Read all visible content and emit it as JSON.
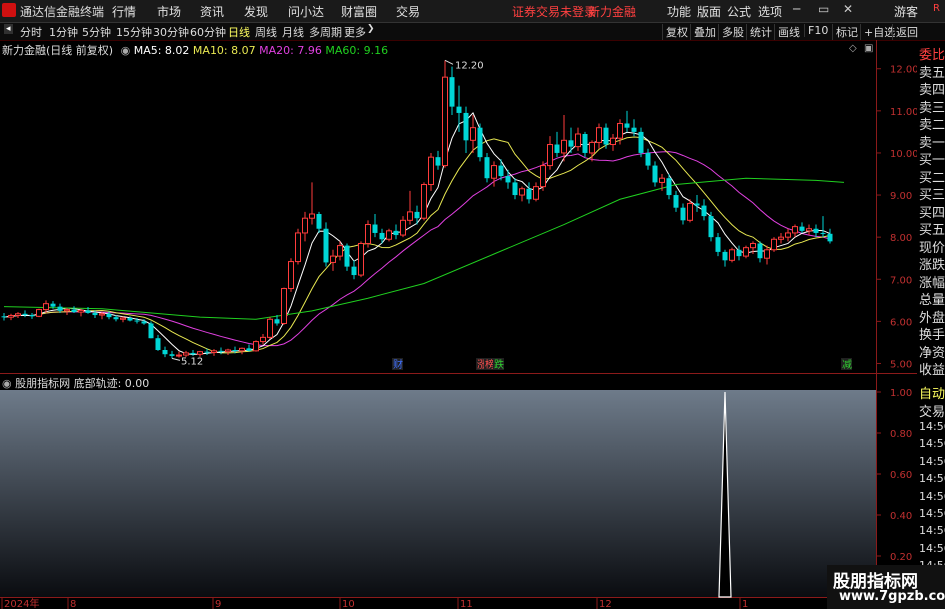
{
  "menu": {
    "app_title": "通达信金融终端",
    "items": [
      "行情",
      "市场",
      "资讯",
      "发现",
      "问小达",
      "财富圈",
      "交易"
    ],
    "status_red": "证券交易未登录",
    "brand_red": "新力金融",
    "right_items": [
      "功能",
      "版面",
      "公式",
      "选项"
    ],
    "guest": "游客",
    "r_badge": "R"
  },
  "toolbar": {
    "periods": [
      "分时",
      "1分钟",
      "5分钟",
      "15分钟",
      "30分钟",
      "60分钟",
      "日线",
      "周线",
      "月线",
      "多周期",
      "更多"
    ],
    "active_period": "日线",
    "right_buttons": [
      "复权",
      "叠加",
      "多股",
      "统计",
      "画线",
      "F10",
      "标记",
      "+自选",
      "返回"
    ]
  },
  "info": {
    "stock": "新力金融(日线 前复权)",
    "ma5": "MA5: 8.02",
    "ma10": "MA10: 8.07",
    "ma20": "MA20: 7.96",
    "ma60": "MA60: 9.16"
  },
  "chart_data": {
    "type": "candlestick",
    "y_ticks": [
      "12.00",
      "11.00",
      "10.00",
      "9.00",
      "8.00",
      "7.00",
      "6.00",
      "5.00"
    ],
    "ylim": [
      4.75,
      12.35
    ],
    "x_ticks": [
      "2024年",
      "8",
      "9",
      "10",
      "11",
      "12",
      "1"
    ],
    "high_label": "12.20",
    "low_label": "5.12",
    "event_markers": [
      "财",
      "涨",
      "榜",
      "跌",
      "减"
    ],
    "colors": {
      "up": "#ff3c3c",
      "down": "#00d6d6",
      "ma5": "#ffffff",
      "ma10": "#e8e852",
      "ma20": "#e040e0",
      "ma60": "#20d020"
    },
    "candles": [
      [
        6.12,
        6.2,
        6.02,
        6.1
      ],
      [
        6.1,
        6.18,
        6.03,
        6.14
      ],
      [
        6.14,
        6.22,
        6.08,
        6.18
      ],
      [
        6.18,
        6.26,
        6.1,
        6.15
      ],
      [
        6.15,
        6.2,
        6.06,
        6.12
      ],
      [
        6.12,
        6.3,
        6.1,
        6.28
      ],
      [
        6.28,
        6.5,
        6.2,
        6.42
      ],
      [
        6.42,
        6.48,
        6.3,
        6.35
      ],
      [
        6.35,
        6.42,
        6.2,
        6.25
      ],
      [
        6.25,
        6.32,
        6.15,
        6.28
      ],
      [
        6.28,
        6.36,
        6.2,
        6.22
      ],
      [
        6.22,
        6.3,
        6.12,
        6.26
      ],
      [
        6.26,
        6.34,
        6.18,
        6.2
      ],
      [
        6.2,
        6.26,
        6.08,
        6.15
      ],
      [
        6.15,
        6.22,
        6.05,
        6.18
      ],
      [
        6.18,
        6.24,
        6.05,
        6.1
      ],
      [
        6.1,
        6.15,
        6.0,
        6.05
      ],
      [
        6.05,
        6.12,
        5.98,
        6.08
      ],
      [
        6.08,
        6.12,
        6.0,
        6.02
      ],
      [
        6.02,
        6.08,
        5.95,
        6.0
      ],
      [
        6.0,
        6.05,
        5.92,
        5.95
      ],
      [
        5.95,
        6.0,
        5.6,
        5.6
      ],
      [
        5.6,
        5.68,
        5.3,
        5.32
      ],
      [
        5.32,
        5.4,
        5.15,
        5.22
      ],
      [
        5.22,
        5.3,
        5.12,
        5.18
      ],
      [
        5.18,
        5.28,
        5.14,
        5.2
      ],
      [
        5.2,
        5.3,
        5.15,
        5.25
      ],
      [
        5.25,
        5.32,
        5.18,
        5.22
      ],
      [
        5.22,
        5.3,
        5.16,
        5.28
      ],
      [
        5.28,
        5.35,
        5.2,
        5.26
      ],
      [
        5.26,
        5.34,
        5.18,
        5.3
      ],
      [
        5.3,
        5.38,
        5.22,
        5.28
      ],
      [
        5.28,
        5.35,
        5.2,
        5.32
      ],
      [
        5.32,
        5.4,
        5.24,
        5.3
      ],
      [
        5.3,
        5.38,
        5.22,
        5.36
      ],
      [
        5.36,
        5.45,
        5.28,
        5.3
      ],
      [
        5.3,
        5.55,
        5.28,
        5.52
      ],
      [
        5.52,
        5.7,
        5.45,
        5.62
      ],
      [
        5.62,
        6.1,
        5.58,
        6.05
      ],
      [
        6.05,
        6.15,
        5.9,
        5.95
      ],
      [
        5.95,
        6.8,
        5.92,
        6.78
      ],
      [
        6.78,
        7.5,
        6.7,
        7.42
      ],
      [
        7.42,
        8.2,
        7.35,
        8.1
      ],
      [
        8.1,
        8.6,
        7.9,
        8.45
      ],
      [
        8.45,
        9.3,
        8.3,
        8.55
      ],
      [
        8.55,
        8.6,
        8.1,
        8.2
      ],
      [
        8.2,
        8.35,
        7.3,
        7.4
      ],
      [
        7.4,
        7.7,
        7.2,
        7.55
      ],
      [
        7.55,
        7.9,
        7.45,
        7.8
      ],
      [
        7.8,
        7.85,
        7.2,
        7.3
      ],
      [
        7.3,
        7.45,
        7.0,
        7.1
      ],
      [
        7.1,
        7.9,
        7.05,
        7.85
      ],
      [
        7.85,
        8.4,
        7.75,
        8.3
      ],
      [
        8.3,
        8.55,
        8.0,
        8.1
      ],
      [
        8.1,
        8.2,
        7.85,
        7.95
      ],
      [
        7.95,
        8.2,
        7.9,
        8.15
      ],
      [
        8.15,
        8.3,
        7.95,
        8.05
      ],
      [
        8.05,
        8.5,
        8.0,
        8.4
      ],
      [
        8.4,
        9.1,
        8.3,
        8.6
      ],
      [
        8.6,
        8.75,
        8.3,
        8.45
      ],
      [
        8.45,
        9.3,
        8.4,
        9.25
      ],
      [
        9.25,
        10.0,
        9.1,
        9.9
      ],
      [
        9.9,
        10.05,
        9.6,
        9.7
      ],
      [
        9.7,
        12.2,
        9.65,
        11.8
      ],
      [
        11.8,
        12.05,
        10.9,
        11.1
      ],
      [
        11.1,
        11.6,
        10.5,
        10.95
      ],
      [
        10.95,
        11.1,
        10.0,
        10.3
      ],
      [
        10.3,
        10.9,
        10.0,
        10.6
      ],
      [
        10.6,
        10.7,
        9.8,
        9.9
      ],
      [
        9.9,
        10.0,
        9.3,
        9.4
      ],
      [
        9.4,
        9.8,
        9.2,
        9.7
      ],
      [
        9.7,
        9.85,
        9.35,
        9.45
      ],
      [
        9.45,
        9.6,
        9.15,
        9.3
      ],
      [
        9.3,
        9.4,
        8.9,
        9.0
      ],
      [
        9.0,
        9.2,
        8.85,
        9.15
      ],
      [
        9.15,
        9.3,
        8.8,
        8.9
      ],
      [
        8.9,
        9.3,
        8.85,
        9.2
      ],
      [
        9.2,
        9.8,
        9.1,
        9.7
      ],
      [
        9.7,
        10.4,
        9.6,
        10.2
      ],
      [
        10.2,
        10.5,
        9.9,
        10.0
      ],
      [
        10.0,
        10.9,
        9.8,
        10.3
      ],
      [
        10.3,
        10.6,
        10.0,
        10.15
      ],
      [
        10.15,
        10.6,
        10.05,
        10.45
      ],
      [
        10.45,
        10.5,
        9.9,
        10.0
      ],
      [
        10.0,
        10.3,
        9.8,
        10.25
      ],
      [
        10.25,
        10.7,
        10.1,
        10.6
      ],
      [
        10.6,
        10.7,
        10.1,
        10.2
      ],
      [
        10.2,
        10.45,
        10.05,
        10.35
      ],
      [
        10.35,
        10.8,
        10.2,
        10.7
      ],
      [
        10.7,
        11.0,
        10.5,
        10.6
      ],
      [
        10.6,
        10.8,
        10.4,
        10.5
      ],
      [
        10.5,
        10.6,
        9.9,
        10.0
      ],
      [
        10.0,
        10.1,
        9.6,
        9.7
      ],
      [
        9.7,
        9.8,
        9.2,
        9.3
      ],
      [
        9.3,
        9.5,
        9.1,
        9.4
      ],
      [
        9.4,
        9.5,
        8.9,
        9.0
      ],
      [
        9.0,
        9.1,
        8.6,
        8.7
      ],
      [
        8.7,
        8.8,
        8.3,
        8.4
      ],
      [
        8.4,
        8.9,
        8.35,
        8.8
      ],
      [
        8.8,
        9.0,
        8.6,
        8.75
      ],
      [
        8.75,
        8.9,
        8.4,
        8.5
      ],
      [
        8.5,
        8.6,
        7.9,
        8.0
      ],
      [
        8.0,
        8.1,
        7.55,
        7.65
      ],
      [
        7.65,
        7.7,
        7.3,
        7.45
      ],
      [
        7.45,
        7.75,
        7.4,
        7.7
      ],
      [
        7.7,
        7.8,
        7.45,
        7.55
      ],
      [
        7.55,
        7.8,
        7.5,
        7.75
      ],
      [
        7.75,
        7.9,
        7.6,
        7.85
      ],
      [
        7.85,
        7.9,
        7.4,
        7.5
      ],
      [
        7.5,
        7.8,
        7.35,
        7.7
      ],
      [
        7.7,
        8.0,
        7.65,
        7.95
      ],
      [
        7.95,
        8.1,
        7.85,
        8.0
      ],
      [
        8.0,
        8.2,
        7.9,
        8.1
      ],
      [
        8.1,
        8.3,
        8.0,
        8.25
      ],
      [
        8.25,
        8.35,
        8.1,
        8.15
      ],
      [
        8.15,
        8.3,
        8.05,
        8.2
      ],
      [
        8.2,
        8.3,
        8.0,
        8.1
      ],
      [
        8.1,
        8.5,
        8.0,
        8.08
      ],
      [
        8.08,
        8.2,
        7.85,
        7.9
      ]
    ],
    "ma60_points": [
      [
        0,
        6.35
      ],
      [
        14,
        6.3
      ],
      [
        28,
        6.1
      ],
      [
        36,
        6.05
      ],
      [
        44,
        6.25
      ],
      [
        52,
        6.55
      ],
      [
        60,
        6.9
      ],
      [
        70,
        7.6
      ],
      [
        80,
        8.3
      ],
      [
        88,
        8.9
      ],
      [
        96,
        9.25
      ],
      [
        106,
        9.4
      ],
      [
        116,
        9.35
      ],
      [
        120,
        9.3
      ]
    ]
  },
  "indicator": {
    "name": "股朋指标网",
    "line_text": "底部轨迹: 0.00",
    "y_ticks": [
      "1.00",
      "0.80",
      "0.60",
      "0.40",
      "0.20"
    ],
    "spike_index": 103
  },
  "side_panel": {
    "items": [
      "委比",
      "卖五",
      "卖四",
      "卖三",
      "卖二",
      "卖一",
      "买一",
      "买二",
      "买三",
      "买四",
      "买五",
      "现价",
      "涨跌",
      "涨幅",
      "总量",
      "外盘",
      "换手",
      "净资",
      "收益"
    ],
    "auto_label": "自动",
    "trade_label": "交易",
    "times": [
      "14:56",
      "14:56",
      "14:56",
      "14:56",
      "14:56",
      "14:56",
      "14:56",
      "14:56",
      "14:56",
      "14:56",
      "14:56"
    ]
  },
  "watermark": {
    "title": "股朋指标网",
    "url": "www.7gpzb.com"
  }
}
